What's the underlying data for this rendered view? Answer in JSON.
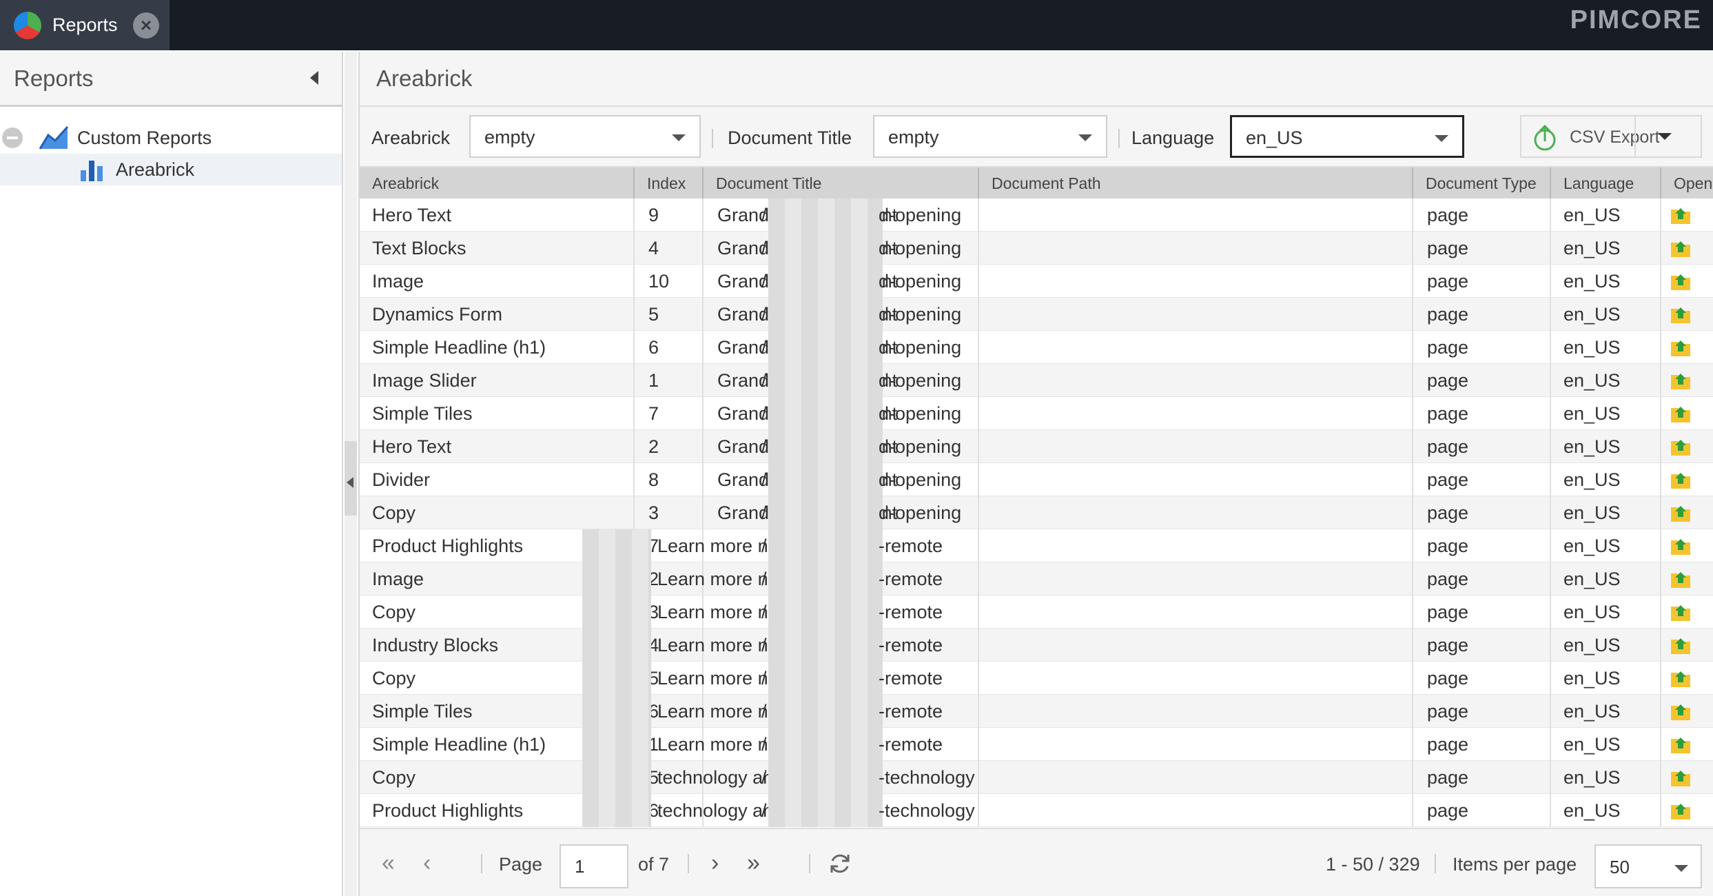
{
  "tab": {
    "title": "Reports"
  },
  "brand": "PIMCORE",
  "left_panel": {
    "title": "Reports",
    "tree": {
      "custom_reports": "Custom Reports",
      "areabrick": "Areabrick"
    }
  },
  "main": {
    "title": "Areabrick",
    "filters": {
      "areabrick_label": "Areabrick",
      "areabrick_value": "empty",
      "doc_title_label": "Document Title",
      "doc_title_value": "empty",
      "language_label": "Language",
      "language_value": "en_US"
    },
    "csv_export": "CSV Export"
  },
  "grid": {
    "columns": [
      "Areabrick",
      "Index",
      "Document Title",
      "Document Path",
      "Document Type",
      "Language",
      "Open"
    ],
    "rows": [
      {
        "areabrick": "Hero Text",
        "index": "9",
        "title_blur": false,
        "title": "Grand Opening Event",
        "path_prefix": "/",
        "path_suffix": "d-opening",
        "type": "page",
        "lang": "en_US"
      },
      {
        "areabrick": "Text Blocks",
        "index": "4",
        "title_blur": false,
        "title": "Grand Opening Event",
        "path_prefix": "/",
        "path_suffix": "d-opening",
        "type": "page",
        "lang": "en_US"
      },
      {
        "areabrick": "Image",
        "index": "10",
        "title_blur": false,
        "title": "Grand Opening Event",
        "path_prefix": "/",
        "path_suffix": "d-opening",
        "type": "page",
        "lang": "en_US"
      },
      {
        "areabrick": "Dynamics Form",
        "index": "5",
        "title_blur": false,
        "title": "Grand Opening Event",
        "path_prefix": "/",
        "path_suffix": "d-opening",
        "type": "page",
        "lang": "en_US"
      },
      {
        "areabrick": "Simple Headline (h1)",
        "index": "6",
        "title_blur": false,
        "title": "Grand Opening Event",
        "path_prefix": "/",
        "path_suffix": "d-opening",
        "type": "page",
        "lang": "en_US"
      },
      {
        "areabrick": "Image Slider",
        "index": "1",
        "title_blur": false,
        "title": "Grand Opening Event",
        "path_prefix": "/",
        "path_suffix": "d-opening",
        "type": "page",
        "lang": "en_US"
      },
      {
        "areabrick": "Simple Tiles",
        "index": "7",
        "title_blur": false,
        "title": "Grand Opening Event",
        "path_prefix": "/",
        "path_suffix": "d-opening",
        "type": "page",
        "lang": "en_US"
      },
      {
        "areabrick": "Hero Text",
        "index": "2",
        "title_blur": false,
        "title": "Grand Opening Event",
        "path_prefix": "/",
        "path_suffix": "d-opening",
        "type": "page",
        "lang": "en_US"
      },
      {
        "areabrick": "Divider",
        "index": "8",
        "title_blur": false,
        "title": "Grand Opening Event",
        "path_prefix": "/",
        "path_suffix": "d-opening",
        "type": "page",
        "lang": "en_US"
      },
      {
        "areabrick": "Copy",
        "index": "3",
        "title_blur": false,
        "title": "Grand Opening Event",
        "path_prefix": "/",
        "path_suffix": "d-opening",
        "type": "page",
        "lang": "en_US"
      },
      {
        "areabrick": "Product Highlights",
        "index": "7",
        "title_blur": true,
        "title": "Learn more n...",
        "path_prefix": "/",
        "path_suffix": "-remote",
        "type": "page",
        "lang": "en_US"
      },
      {
        "areabrick": "Image",
        "index": "2",
        "title_blur": true,
        "title": "Learn more n...",
        "path_prefix": "/",
        "path_suffix": "-remote",
        "type": "page",
        "lang": "en_US"
      },
      {
        "areabrick": "Copy",
        "index": "3",
        "title_blur": true,
        "title": "Learn more n...",
        "path_prefix": "/",
        "path_suffix": "-remote",
        "type": "page",
        "lang": "en_US"
      },
      {
        "areabrick": "Industry Blocks",
        "index": "4",
        "title_blur": true,
        "title": "Learn more n...",
        "path_prefix": "/",
        "path_suffix": "-remote",
        "type": "page",
        "lang": "en_US"
      },
      {
        "areabrick": "Copy",
        "index": "5",
        "title_blur": true,
        "title": "Learn more n...",
        "path_prefix": "/",
        "path_suffix": "-remote",
        "type": "page",
        "lang": "en_US"
      },
      {
        "areabrick": "Simple Tiles",
        "index": "6",
        "title_blur": true,
        "title": "Learn more n...",
        "path_prefix": "/",
        "path_suffix": "-remote",
        "type": "page",
        "lang": "en_US"
      },
      {
        "areabrick": "Simple Headline (h1)",
        "index": "1",
        "title_blur": true,
        "title": "Learn more n...",
        "path_prefix": "/",
        "path_suffix": "-remote",
        "type": "page",
        "lang": "en_US"
      },
      {
        "areabrick": "Copy",
        "index": "5",
        "title_blur": true,
        "title": "technology an...",
        "path_prefix": "/",
        "path_suffix": "-technology",
        "type": "page",
        "lang": "en_US"
      },
      {
        "areabrick": "Product Highlights",
        "index": "6",
        "title_blur": true,
        "title": "technology an...",
        "path_prefix": "/",
        "path_suffix": "-technology",
        "type": "page",
        "lang": "en_US"
      }
    ]
  },
  "pager": {
    "page_label": "Page",
    "page_value": "1",
    "of_label": "of 7",
    "range": "1 - 50 / 329",
    "items_per_page_label": "Items per page",
    "items_per_page_value": "50"
  },
  "colors": {
    "topbar": "#181c25",
    "tab": "#353c48",
    "header_bg": "#d4d4d4",
    "alt_row": "#f4f4f4"
  }
}
